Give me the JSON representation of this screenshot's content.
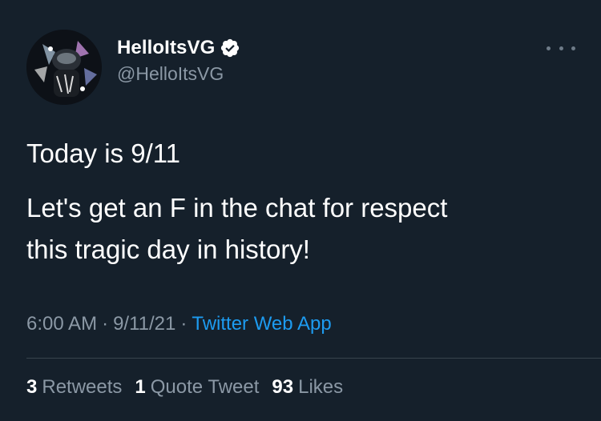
{
  "tweet": {
    "display_name": "HelloItsVG",
    "handle": "@HelloItsVG",
    "verified": true,
    "avatar_icon": "profile-avatar",
    "more_icon": "more-options-icon",
    "text_lines": [
      "Today is 9/11",
      "Let's get an F in the chat for respect",
      "this tragic day in history!"
    ],
    "time": "6:00 AM",
    "date": "9/11/21",
    "source": "Twitter Web App",
    "separator": "·"
  },
  "stats": {
    "retweets_count": "3",
    "retweets_label": "Retweets",
    "quotes_count": "1",
    "quotes_label": "Quote Tweet",
    "likes_count": "93",
    "likes_label": "Likes"
  },
  "colors": {
    "background": "#15202b",
    "text_primary": "#ffffff",
    "text_secondary": "#8b98a5",
    "link": "#1d9bf0",
    "divider": "#38444d"
  }
}
